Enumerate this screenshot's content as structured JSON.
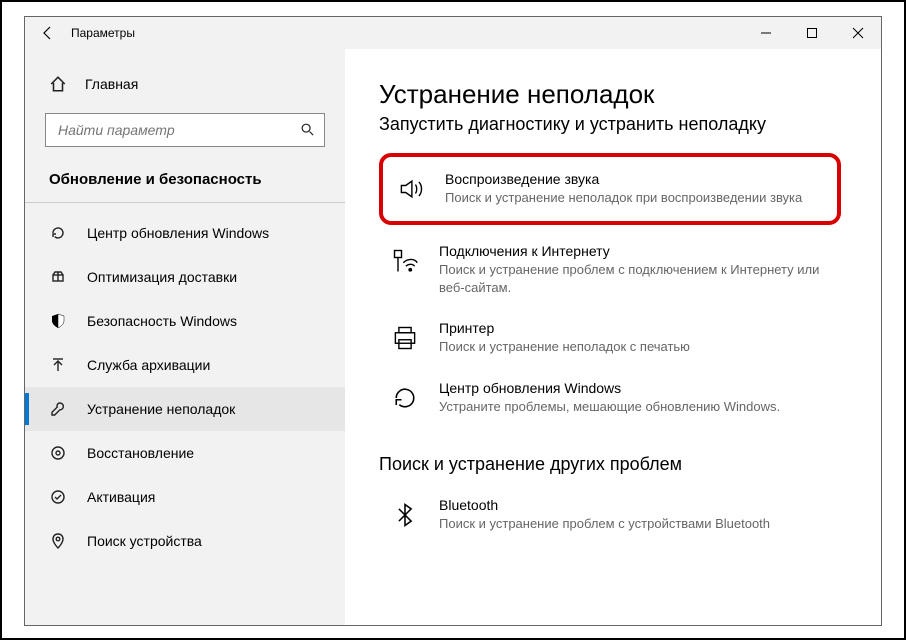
{
  "window": {
    "title": "Параметры"
  },
  "sidebar": {
    "home_label": "Главная",
    "search_placeholder": "Найти параметр",
    "section_heading": "Обновление и безопасность",
    "items": [
      {
        "label": "Центр обновления Windows",
        "icon": "refresh"
      },
      {
        "label": "Оптимизация доставки",
        "icon": "delivery"
      },
      {
        "label": "Безопасность Windows",
        "icon": "shield"
      },
      {
        "label": "Служба архивации",
        "icon": "backup"
      },
      {
        "label": "Устранение неполадок",
        "icon": "wrench",
        "selected": true
      },
      {
        "label": "Восстановление",
        "icon": "recovery"
      },
      {
        "label": "Активация",
        "icon": "activation"
      },
      {
        "label": "Поиск устройства",
        "icon": "find-device"
      }
    ]
  },
  "content": {
    "title": "Устранение неполадок",
    "subtitle": "Запустить диагностику и устранить неполадку",
    "section2_title": "Поиск и устранение других проблем",
    "items": [
      {
        "name": "Воспроизведение звука",
        "desc": "Поиск и устранение неполадок при воспроизведении звука",
        "icon": "speaker",
        "highlighted": true
      },
      {
        "name": "Подключения к Интернету",
        "desc": "Поиск и устранение проблем с подключением к Интернету или веб-сайтам.",
        "icon": "wifi"
      },
      {
        "name": "Принтер",
        "desc": "Поиск и устранение неполадок с печатью",
        "icon": "printer"
      },
      {
        "name": "Центр обновления Windows",
        "desc": "Устраните проблемы, мешающие обновлению Windows.",
        "icon": "refresh"
      }
    ],
    "items2": [
      {
        "name": "Bluetooth",
        "desc": "Поиск и устранение проблем с устройствами Bluetooth",
        "icon": "bluetooth"
      }
    ]
  }
}
